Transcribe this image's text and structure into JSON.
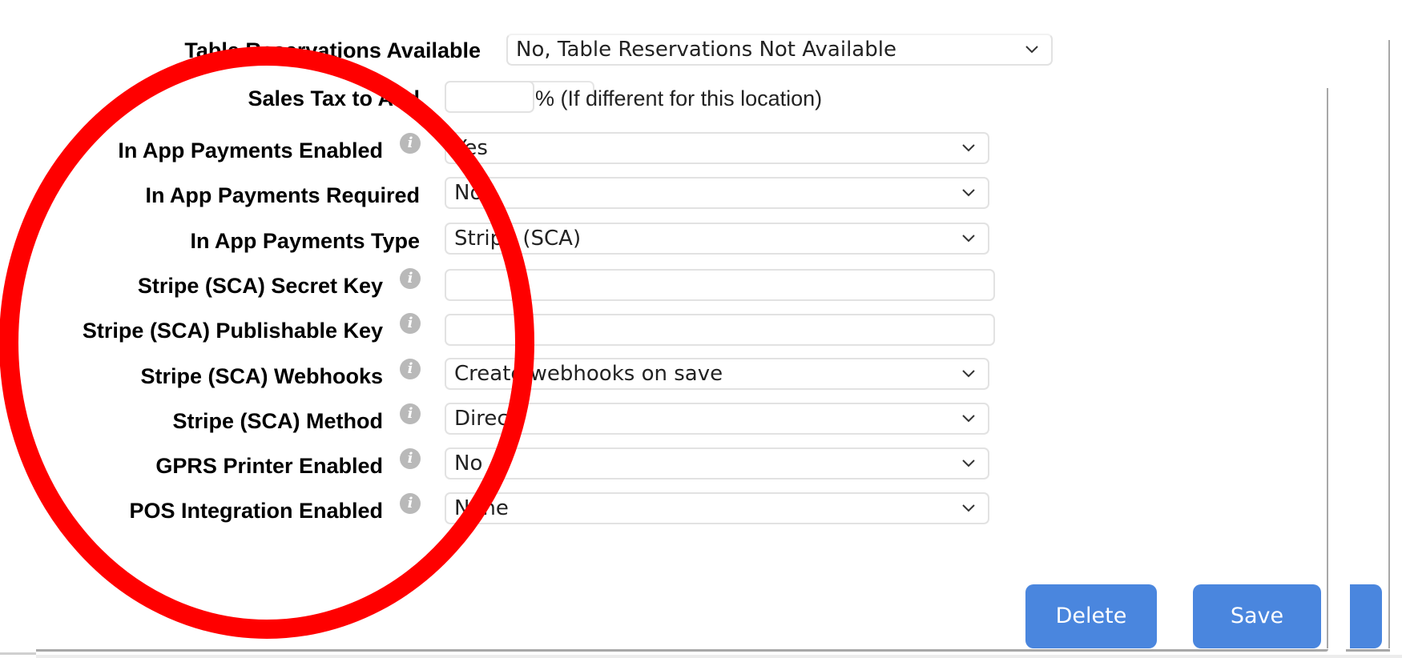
{
  "form": {
    "table_reservations": {
      "label": "Table Reservations Available",
      "value": "No, Table Reservations Not Available"
    },
    "sales_tax": {
      "label": "Sales Tax to Add",
      "value": "",
      "suffix": "% (If different for this location)"
    },
    "fields": [
      {
        "key": "in_app_payments_enabled",
        "label": "In App Payments Enabled",
        "type": "select",
        "value": "Yes",
        "info": true
      },
      {
        "key": "in_app_payments_required",
        "label": "In App Payments Required",
        "type": "select",
        "value": "No",
        "info": false
      },
      {
        "key": "in_app_payments_type",
        "label": "In App Payments Type",
        "type": "select",
        "value": "Stripe (SCA)",
        "info": false
      },
      {
        "key": "stripe_sca_secret_key",
        "label": "Stripe (SCA) Secret Key",
        "type": "text",
        "value": "",
        "info": true
      },
      {
        "key": "stripe_sca_publishable_key",
        "label": "Stripe (SCA) Publishable Key",
        "type": "text",
        "value": "",
        "info": true
      },
      {
        "key": "stripe_sca_webhooks",
        "label": "Stripe (SCA) Webhooks",
        "type": "select",
        "value": "Create webhooks on save",
        "info": true
      },
      {
        "key": "stripe_sca_method",
        "label": "Stripe (SCA) Method",
        "type": "select",
        "value": "Direct",
        "info": true
      },
      {
        "key": "gprs_printer_enabled",
        "label": "GPRS Printer Enabled",
        "type": "select",
        "value": "No",
        "info": true
      },
      {
        "key": "pos_integration_enabled",
        "label": "POS Integration Enabled",
        "type": "select",
        "value": "None",
        "info": true
      }
    ]
  },
  "icons": {
    "info": "i",
    "chevron": "chevron-down-icon"
  },
  "actions": {
    "delete_label": "Delete",
    "save_label": "Save"
  },
  "annotation": {
    "shape": "ellipse",
    "color": "#ff0000"
  },
  "colors": {
    "button": "#4a86de",
    "info_icon": "#b9b9b9",
    "border": "#e2e2e2"
  }
}
